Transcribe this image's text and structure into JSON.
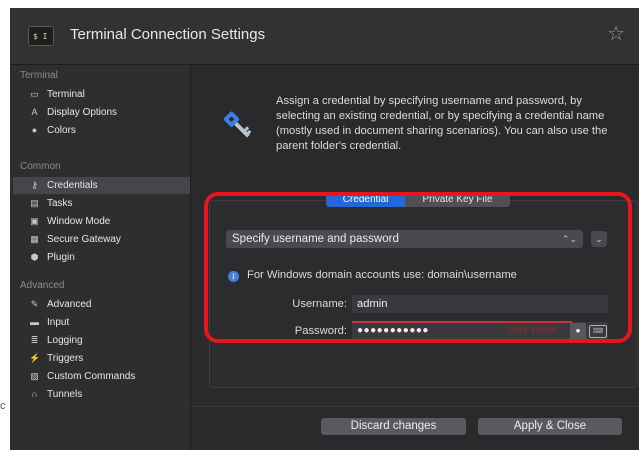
{
  "window": {
    "title": "Terminal Connection Settings",
    "app_icon_glyph": "$ I",
    "star_glyph": "☆"
  },
  "sidebar": {
    "sections": [
      {
        "header": "Terminal",
        "items": [
          {
            "label": "Terminal",
            "icon": "terminal-icon"
          },
          {
            "label": "Display Options",
            "icon": "display-options-icon"
          },
          {
            "label": "Colors",
            "icon": "colors-icon"
          }
        ]
      },
      {
        "header": "Common",
        "items": [
          {
            "label": "Credentials",
            "icon": "key-icon",
            "active": true
          },
          {
            "label": "Tasks",
            "icon": "tasks-icon"
          },
          {
            "label": "Window Mode",
            "icon": "window-mode-icon"
          },
          {
            "label": "Secure Gateway",
            "icon": "secure-gateway-icon"
          },
          {
            "label": "Plugin",
            "icon": "plugin-icon"
          }
        ]
      },
      {
        "header": "Advanced",
        "items": [
          {
            "label": "Advanced",
            "icon": "wrench-icon"
          },
          {
            "label": "Input",
            "icon": "keyboard-icon"
          },
          {
            "label": "Logging",
            "icon": "logging-icon"
          },
          {
            "label": "Triggers",
            "icon": "triggers-icon"
          },
          {
            "label": "Custom Commands",
            "icon": "custom-commands-icon"
          },
          {
            "label": "Tunnels",
            "icon": "tunnels-icon"
          }
        ]
      }
    ]
  },
  "content": {
    "description": "Assign a credential by specifying username and password, by selecting an existing credential, or by specifying a credential name (mostly used in document sharing scenarios). You can also use the parent folder's credential.",
    "tabs": [
      {
        "label": "Credential",
        "selected": true
      },
      {
        "label": "Private Key File",
        "selected": false
      }
    ],
    "credential_mode": {
      "selected": "Specify username and password",
      "arrow_glyph": "⌃⌄",
      "more_glyph": "⌄"
    },
    "info_text": "For Windows domain accounts use: domain\\username",
    "username": {
      "label": "Username:",
      "value": "admin"
    },
    "password": {
      "label": "Password:",
      "masked_value": "●●●●●●●●●●●",
      "strength": "Very Weak"
    }
  },
  "footer": {
    "discard_label": "Discard changes",
    "apply_label": "Apply & Close"
  },
  "annotation": {
    "color": "#e8141e"
  },
  "colors": {
    "accent": "#2467d6",
    "strength_weak": "#c0392b"
  }
}
